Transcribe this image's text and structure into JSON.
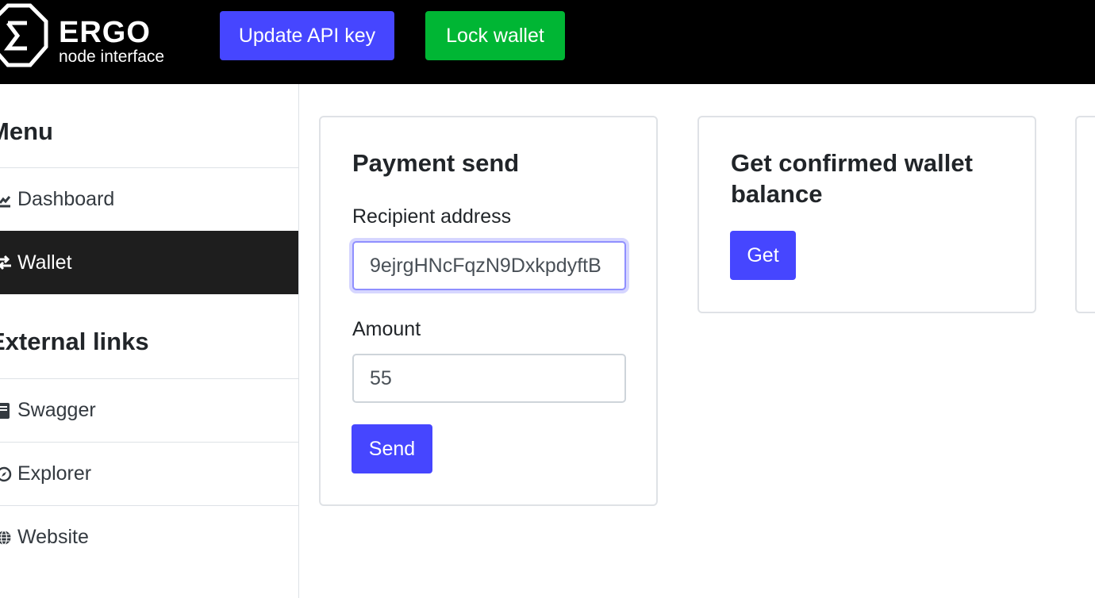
{
  "header": {
    "brand_name": "ERGO",
    "brand_sub": "node interface",
    "update_api_key_label": "Update API key",
    "lock_wallet_label": "Lock wallet",
    "colors": {
      "background": "#000000",
      "update_button": "#4646ff",
      "lock_button": "#00b634"
    }
  },
  "sidebar": {
    "menu_heading": "Menu",
    "menu_items": [
      {
        "label": "Dashboard",
        "icon": "chart-line-icon"
      },
      {
        "label": "Wallet",
        "icon": "exchange-icon",
        "active": true
      }
    ],
    "links_heading": "External links",
    "link_items": [
      {
        "label": "Swagger",
        "icon": "book-icon"
      },
      {
        "label": "Explorer",
        "icon": "compass-icon"
      },
      {
        "label": "Website",
        "icon": "globe-icon"
      }
    ]
  },
  "payment_card": {
    "title": "Payment send",
    "recipient_label": "Recipient address",
    "recipient_value": "9ejrgHNcFqzN9DxkpdyftB",
    "amount_label": "Amount",
    "amount_value": "55",
    "send_label": "Send"
  },
  "balance_card": {
    "title": "Get confirmed wallet balance",
    "get_label": "Get"
  },
  "accent_color": "#4646ff"
}
